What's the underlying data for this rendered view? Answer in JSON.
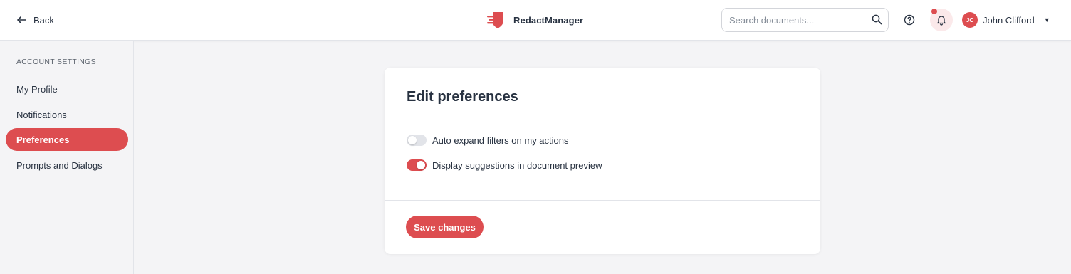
{
  "header": {
    "back_label": "Back",
    "brand_name": "RedactManager",
    "search": {
      "placeholder": "Search documents...",
      "value": ""
    },
    "user": {
      "initials": "JC",
      "name": "John Clifford"
    }
  },
  "sidebar": {
    "heading": "ACCOUNT SETTINGS",
    "items": [
      {
        "label": "My Profile",
        "active": false
      },
      {
        "label": "Notifications",
        "active": false
      },
      {
        "label": "Preferences",
        "active": true
      },
      {
        "label": "Prompts and Dialogs",
        "active": false
      }
    ]
  },
  "main": {
    "title": "Edit preferences",
    "preferences": [
      {
        "label": "Auto expand filters on my actions",
        "enabled": false
      },
      {
        "label": "Display suggestions in document preview",
        "enabled": true
      }
    ],
    "save_label": "Save changes"
  },
  "colors": {
    "accent": "#dd4d50",
    "text": "#283241",
    "background": "#f4f4f6",
    "toggle_off": "#e2e4e9"
  }
}
